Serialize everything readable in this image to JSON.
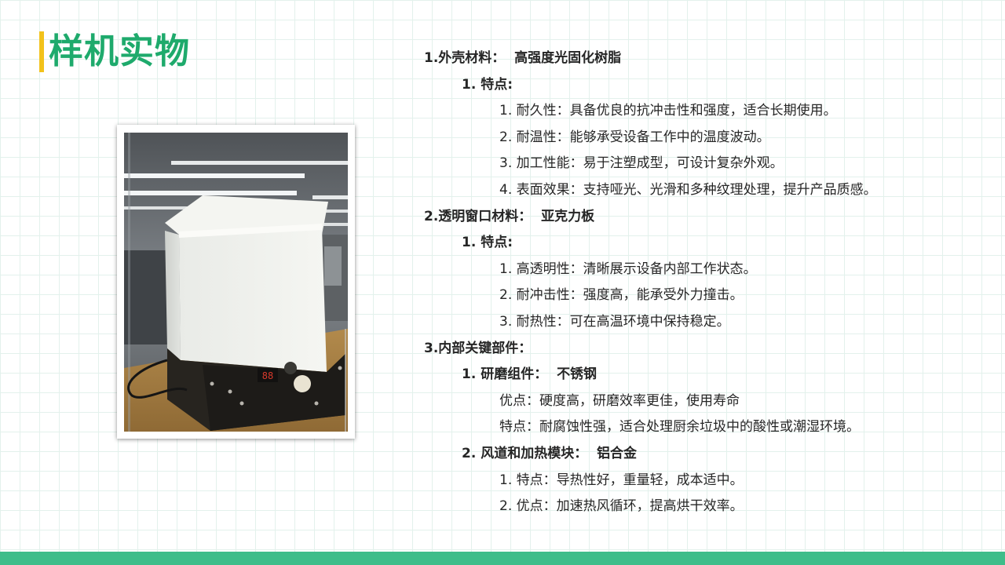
{
  "title": "样机实物",
  "sections": [
    {
      "heading": "1.外壳材料：",
      "material": "高强度光固化树脂",
      "sub_heading": "1.  特点:",
      "items": [
        "1. 耐久性：具备优良的抗冲击性和强度，适合长期使用。",
        "2. 耐温性：能够承受设备工作中的温度波动。",
        "3. 加工性能：易于注塑成型，可设计复杂外观。",
        "4. 表面效果：支持哑光、光滑和多种纹理处理，提升产品质感。"
      ]
    },
    {
      "heading": "2.透明窗口材料：",
      "material": "亚克力板",
      "sub_heading": "1.  特点:",
      "items": [
        "1. 高透明性：清晰展示设备内部工作状态。",
        "2. 耐冲击性：强度高，能承受外力撞击。",
        "3. 耐热性：可在高温环境中保持稳定。"
      ]
    },
    {
      "heading": "3.内部关键部件：",
      "subsections": [
        {
          "heading": "1.  研磨组件：",
          "material": "不锈钢",
          "lines": [
            "优点：硬度高，研磨效率更佳，使用寿命",
            "特点：耐腐蚀性强，适合处理厨余垃圾中的酸性或潮湿环境。"
          ]
        },
        {
          "heading": "2.  风道和加热模块：",
          "material": "铝合金",
          "lines": [
            "1. 特点：导热性好，重量轻，成本适中。",
            "2. 优点：加速热风循环，提高烘干效率。"
          ]
        }
      ]
    }
  ],
  "photo": {
    "display_digits": "88"
  },
  "colors": {
    "title": "#1eaa6c",
    "title_bar": "#f2c21b",
    "bottom_band": "#3ebd8a",
    "grid": "#e3f1ec"
  }
}
